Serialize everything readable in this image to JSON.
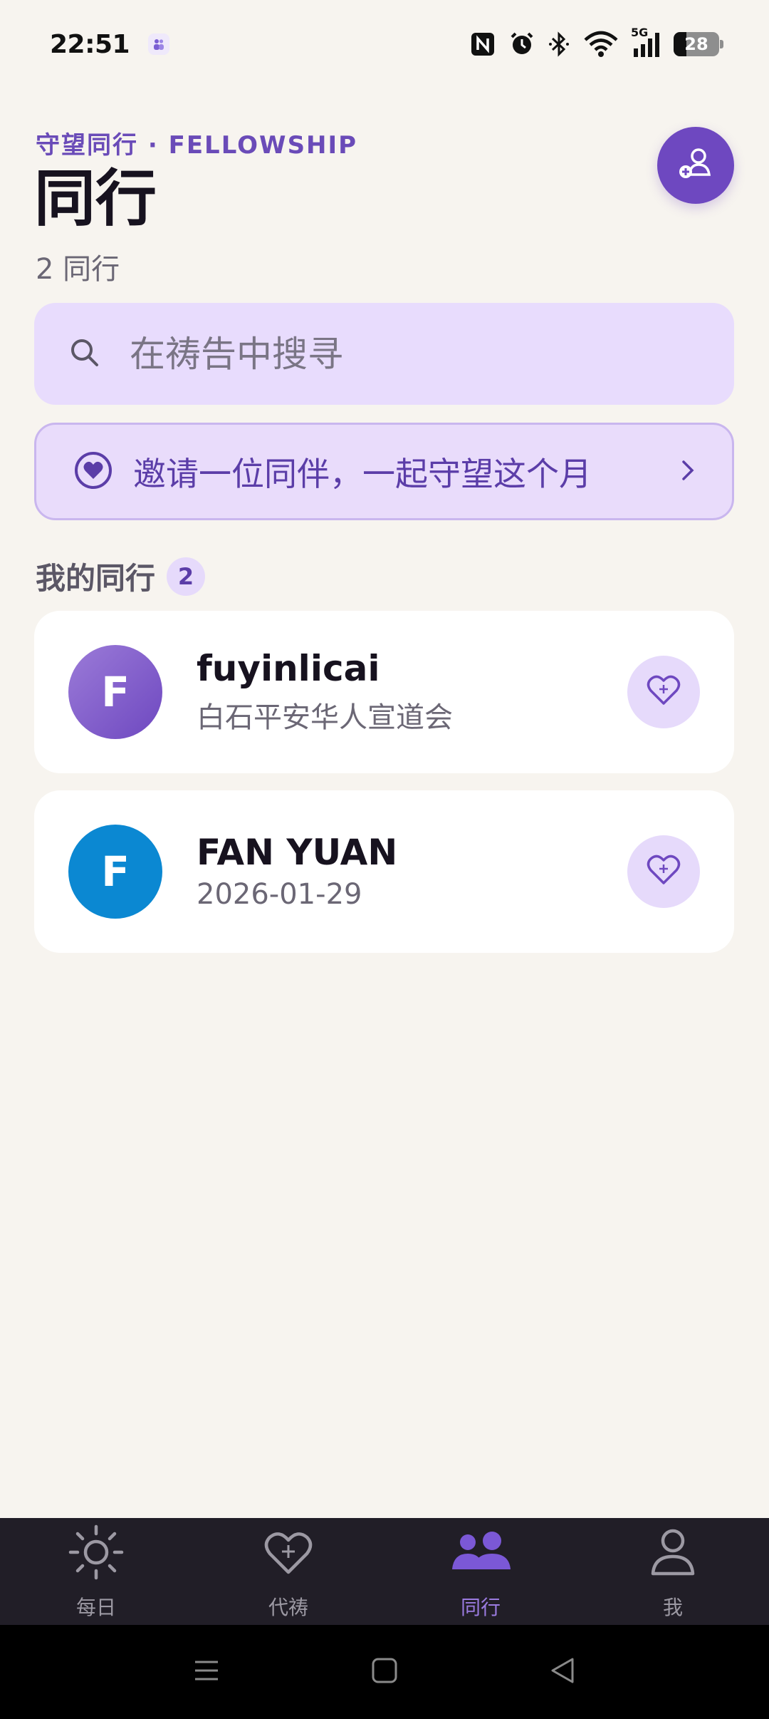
{
  "status_bar": {
    "time": "22:51",
    "app_icon": "people-notification-icon",
    "icons": [
      "nfc-icon",
      "alarm-icon",
      "bluetooth-icon",
      "wifi-icon",
      "signal-5g-icon"
    ],
    "network_label": "5G",
    "battery_level": "28"
  },
  "header": {
    "eyebrow": "守望同行 · FELLOWSHIP",
    "title": "同行",
    "count_text": "2 同行",
    "add_button_icon": "add-person-icon"
  },
  "search": {
    "placeholder": "在祷告中搜寻",
    "value": "",
    "icon": "search-icon"
  },
  "invite": {
    "label": "邀请一位同伴，一起守望这个月",
    "icon": "heart-circle-icon",
    "chevron": "chevron-right-icon"
  },
  "section": {
    "title": "我的同行",
    "count": "2"
  },
  "companions": [
    {
      "initial": "F",
      "name": "fuyinlicai",
      "subtitle": "白石平安华人宣道会",
      "avatar_color": "#7B58C8"
    },
    {
      "initial": "F",
      "name": "FAN YUAN",
      "subtitle": "2026-01-29",
      "avatar_color": "#0B88D2"
    }
  ],
  "bottom_nav": {
    "items": [
      {
        "label": "每日",
        "icon": "sun-icon"
      },
      {
        "label": "代祷",
        "icon": "heart-plus-icon"
      },
      {
        "label": "同行",
        "icon": "people-icon",
        "active": true
      },
      {
        "label": "我",
        "icon": "person-icon"
      }
    ]
  },
  "system_nav": {
    "icons": [
      "menu-icon",
      "home-icon",
      "back-icon"
    ]
  },
  "colors": {
    "accent": "#6E48C0",
    "background": "#F7F4EF",
    "nav_background": "#211E27"
  }
}
